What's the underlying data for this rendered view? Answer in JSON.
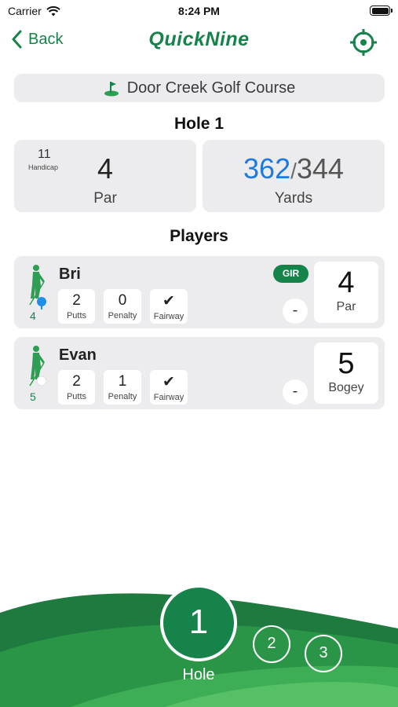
{
  "status": {
    "carrier": "Carrier",
    "time": "8:24 PM"
  },
  "nav": {
    "back_label": "Back",
    "title": "QuickNine"
  },
  "course": {
    "name": "Door Creek Golf Course"
  },
  "hole": {
    "title": "Hole 1",
    "handicap": "11",
    "handicap_label": "Handicap",
    "par": "4",
    "par_label": "Par",
    "yards_primary": "362",
    "yards_secondary": "344",
    "yards_separator": "/",
    "yards_label": "Yards"
  },
  "players_title": "Players",
  "players": [
    {
      "name": "Bri",
      "number": "4",
      "gir": "GIR",
      "putts": "2",
      "putts_label": "Putts",
      "penalty": "0",
      "penalty_label": "Penalty",
      "fairway": "✔",
      "fairway_label": "Fairway",
      "minus": "-",
      "score": "4",
      "score_label": "Par"
    },
    {
      "name": "Evan",
      "number": "5",
      "putts": "2",
      "putts_label": "Putts",
      "penalty": "1",
      "penalty_label": "Penalty",
      "fairway": "✔",
      "fairway_label": "Fairway",
      "minus": "-",
      "score": "5",
      "score_label": "Bogey"
    }
  ],
  "hole_selector": {
    "current": "1",
    "label": "Hole",
    "next": "2",
    "after": "3"
  },
  "colors": {
    "accent": "#16834a",
    "blue": "#1f7ae0",
    "card": "#ececee"
  }
}
